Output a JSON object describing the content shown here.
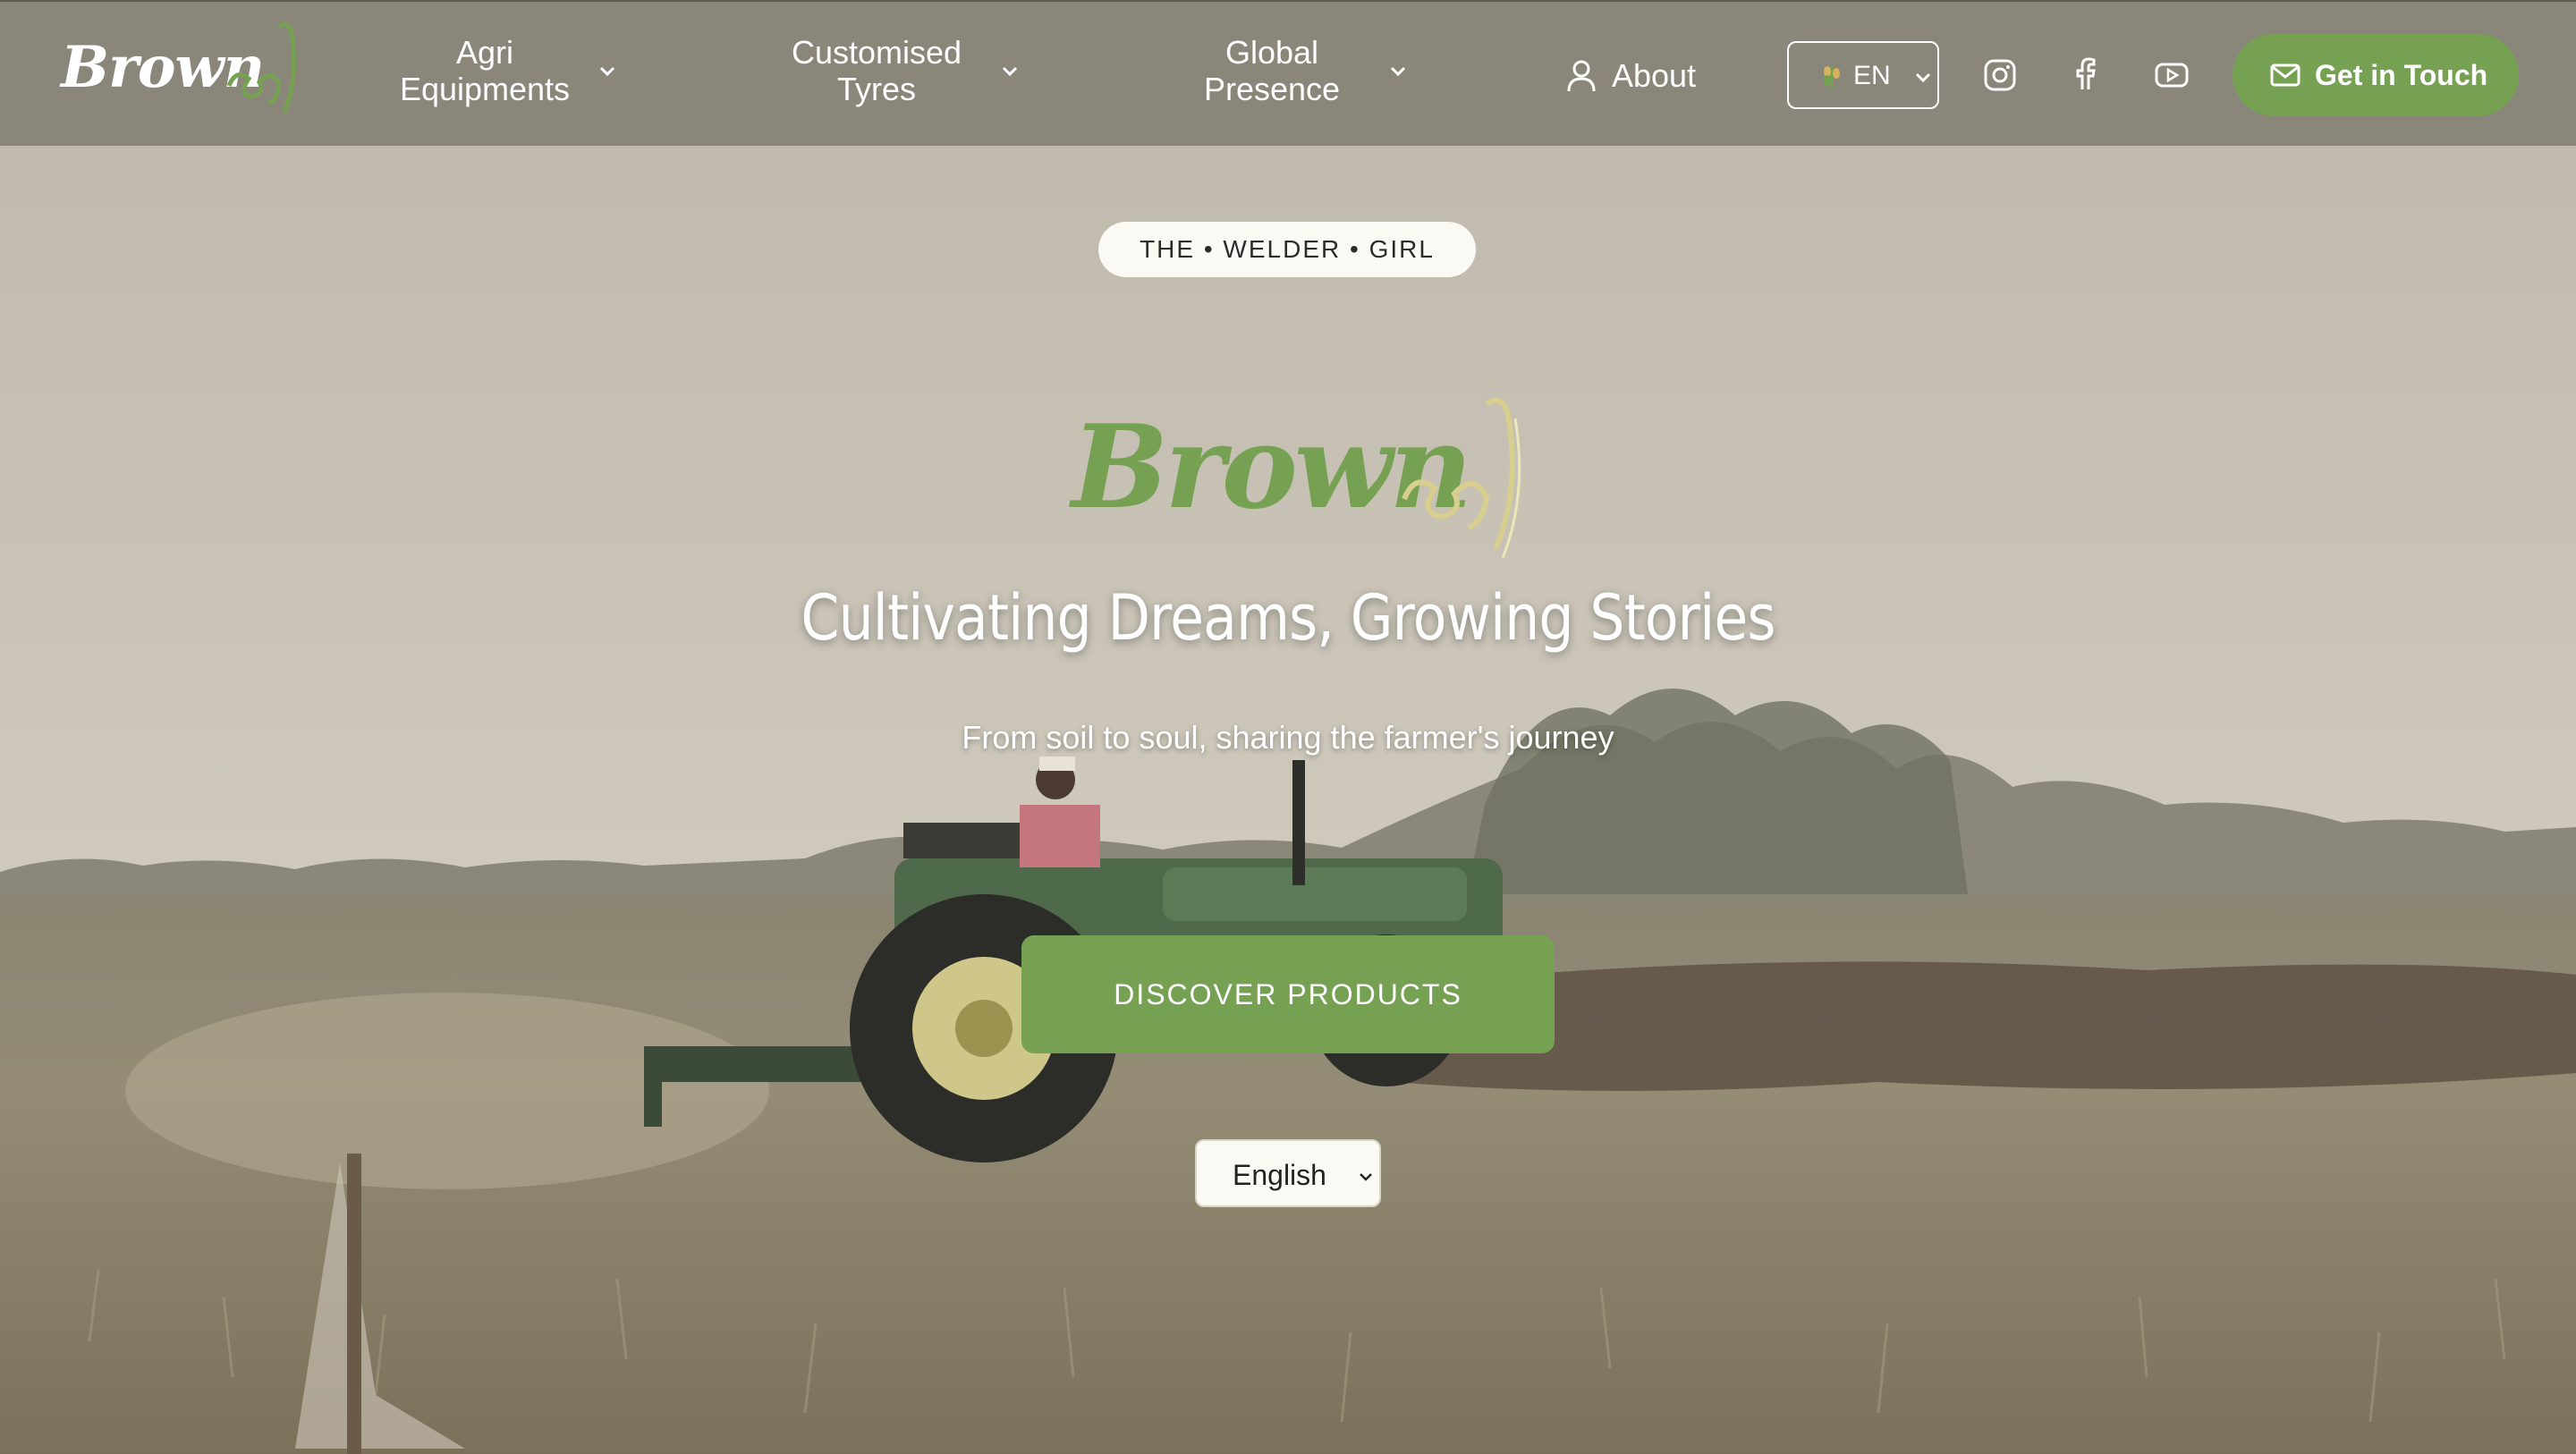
{
  "brand": {
    "name": "Brown",
    "agri_script": "ಕೃಷಿ"
  },
  "nav": {
    "items": [
      {
        "line1": "Agri",
        "line2": "Equipments"
      },
      {
        "line1": "Customised",
        "line2": "Tyres"
      },
      {
        "line1": "Global",
        "line2": "Presence"
      }
    ],
    "about_label": "About",
    "language_code": "EN",
    "social_icons": [
      "instagram-icon",
      "facebook-icon",
      "youtube-icon"
    ],
    "cta_label": "Get in Touch"
  },
  "hero": {
    "tagline_pill": "THE • WELDER • GIRL",
    "headline": "Cultivating Dreams, Growing Stories",
    "subheadline": "From soil to soul, sharing the farmer's journey",
    "primary_button": "DISCOVER PRODUCTS",
    "language_select": {
      "selected": "English"
    }
  },
  "colors": {
    "accent_green": "#76a153",
    "navbar_bg": "#8a8679",
    "agri_script_color": "#d8cf8f"
  }
}
